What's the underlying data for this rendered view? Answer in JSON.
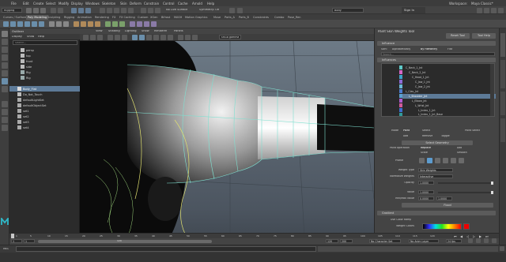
{
  "menubar": {
    "items": [
      "File",
      "Edit",
      "Create",
      "Select",
      "Modify",
      "Display",
      "Windows",
      "Skeleton",
      "Skin",
      "Deform",
      "Constrain",
      "Control",
      "Cache",
      "Arnold",
      "Help"
    ],
    "workspace_label": "Workspace:",
    "workspace_value": "Maya Classic*"
  },
  "statusline": {
    "mode": "Rigging",
    "no_live_surface": "No Live Surface",
    "symmetry": "Symmetry: Off",
    "object_field": "Body",
    "sign_in": "Sign In"
  },
  "shelf": {
    "tabs": [
      "Curves / Surfaces",
      "Poly Modeling",
      "Sculpting",
      "Rigging",
      "Animation",
      "Rendering",
      "FX",
      "FX Caching",
      "Custom",
      "XGen",
      "Bifrost",
      "MASH",
      "Motion Graphics",
      "Muse",
      "Parts_A",
      "Parts_B",
      "Constraints",
      "Combo",
      "Pose_Ren"
    ],
    "active_tab_index": 1
  },
  "outliner": {
    "title": "Outliner",
    "menu": [
      "Display",
      "Show",
      "Help"
    ],
    "search_placeholder": "Search...",
    "items": [
      {
        "label": "persp",
        "selected": false
      },
      {
        "label": "top",
        "selected": false
      },
      {
        "label": "front",
        "selected": false
      },
      {
        "label": "side",
        "selected": false
      },
      {
        "label": "Rig",
        "selected": false
      },
      {
        "label": "Rig",
        "selected": false
      },
      {
        "label": "Body_Flat",
        "selected": true
      },
      {
        "label": "Do_Not_Touch",
        "selected": false
      },
      {
        "label": "defaultLightSet",
        "selected": false
      },
      {
        "label": "defaultObjectSet",
        "selected": false
      },
      {
        "label": "set1",
        "selected": false
      },
      {
        "label": "set2",
        "selected": false
      },
      {
        "label": "set3",
        "selected": false
      },
      {
        "label": "set4",
        "selected": false
      }
    ]
  },
  "viewport": {
    "menu": [
      "View",
      "Shading",
      "Lighting",
      "Show",
      "Renderer",
      "Panels"
    ],
    "color_space": "sRGB gamma",
    "camera_label": "top -Y"
  },
  "attribute_panel": {
    "title": "Paint Skin Weights Tool",
    "reset_button": "Reset Tool",
    "help_button": "Tool Help",
    "section_influence": "Influence",
    "sort_label": "Sort:",
    "sort_options": [
      "Alphabetically",
      "By Hierarchy",
      "Flat"
    ],
    "sort_selected": "By Hierarchy",
    "search_placeholder": "Search...",
    "section_influences": "Influences",
    "joints": [
      {
        "label": "C_Neck_1_Jnt",
        "indent": 0,
        "color": "#5ec8c8",
        "selected": false
      },
      {
        "label": "C_Neck_2_Jnt",
        "indent": 1,
        "color": "#d466c6",
        "selected": false
      },
      {
        "label": "C_Head_1_Jnt",
        "indent": 2,
        "color": "#3fa2c8",
        "selected": false
      },
      {
        "label": "C_Jaw_1_Jnt",
        "indent": 3,
        "color": "#8e6ad6",
        "selected": false
      },
      {
        "label": "C_Jaw_2_Jnt",
        "indent": 3,
        "color": "#6ab6d6",
        "selected": false
      },
      {
        "label": "L_Clav_Jnt",
        "indent": 0,
        "color": "#4e7dd0",
        "selected": false
      },
      {
        "label": "L_Shoulder_Jnt",
        "indent": 1,
        "color": "#5aa0d0",
        "selected": true
      },
      {
        "label": "L_Elbow_Jnt",
        "indent": 2,
        "color": "#b05ad0",
        "selected": false
      },
      {
        "label": "L_Wrist_Jnt",
        "indent": 3,
        "color": "#d05a9a",
        "selected": false
      },
      {
        "label": "L_Index_1_Jnt",
        "indent": 4,
        "color": "#3e6ed0",
        "selected": false
      },
      {
        "label": "L_Index_1_Jnt_Base",
        "indent": 4,
        "color": "#2f9a9a",
        "selected": false
      }
    ],
    "mode_label": "Mode",
    "mode_options": [
      "Paint",
      "Select",
      "Paint Select"
    ],
    "mode_selected": "Paint",
    "add_remove": [
      "Add",
      "Remove",
      "Toggle"
    ],
    "select_geometry": "Select Geometry",
    "paint_op_label": "Paint operation",
    "paint_ops": [
      "Replace",
      "Add",
      "Scale",
      "Smooth"
    ],
    "paint_op_selected": "Replace",
    "profile_label": "Profile",
    "weight_type_label": "Weight Type",
    "weight_type_value": "Skin Weights",
    "normalize_label": "Normalize Weights",
    "normalize_value": "Interactive",
    "opacity_label": "Opacity",
    "opacity_value": "1.0000",
    "value_label": "Value",
    "value_value": "1.0000",
    "minmax_label": "Min/Max value",
    "min_value": "0.0000",
    "max_value": "1.0000",
    "flood_button": "Flood",
    "section_gradient": "Gradient",
    "use_color_ramp": "Use Color Ramp",
    "weight_colors": "Weight Colors",
    "stroke_label": "Stroke"
  },
  "timeslider": {
    "ticks": [
      "5",
      "10",
      "15",
      "20",
      "25",
      "30",
      "35",
      "40",
      "45",
      "50",
      "55",
      "60",
      "65",
      "70",
      "75",
      "80",
      "85",
      "90",
      "95",
      "100",
      "105",
      "110",
      "115",
      "120"
    ],
    "current_frame": "1"
  },
  "rangeslider": {
    "start": "1",
    "start_inner": "1",
    "end_inner": "120",
    "end": "120",
    "end2": "200",
    "character_set": "No Character Set",
    "anim_layer": "No Anim Layer",
    "fps": "24 fps"
  },
  "cmdline": {
    "lang": "MEL"
  },
  "colors": {
    "accent": "#5d7a97",
    "panel_bg": "#444444",
    "dark_bg": "#2b2b2b"
  }
}
